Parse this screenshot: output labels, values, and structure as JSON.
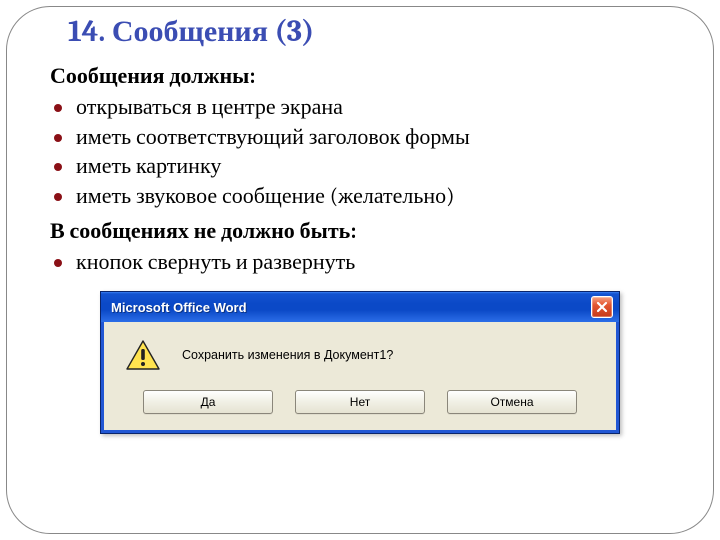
{
  "slide": {
    "title": "14. Сообщения (3)",
    "subhead1": "Сообщения должны:",
    "bullets1": [
      "открываться в центре экрана",
      "иметь соответствующий заголовок формы",
      "иметь картинку",
      "иметь звуковое сообщение (желательно)"
    ],
    "subhead2": "В сообщениях не должно быть:",
    "bullets2": [
      "кнопок свернуть и развернуть"
    ]
  },
  "dialog": {
    "caption": "Microsoft Office Word",
    "message": "Сохранить изменения в Документ1?",
    "buttons": {
      "yes": "Да",
      "no": "Нет",
      "cancel": "Отмена"
    }
  }
}
